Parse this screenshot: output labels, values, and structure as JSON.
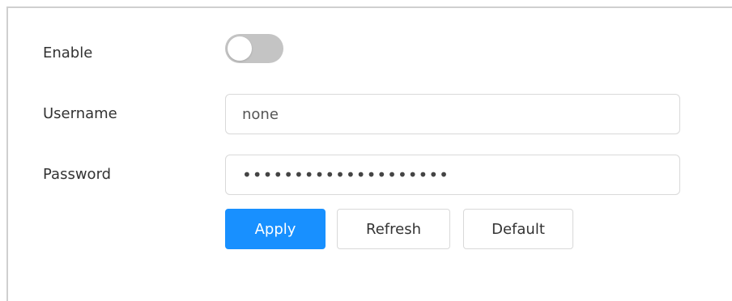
{
  "form": {
    "enable": {
      "label": "Enable",
      "enabled": false
    },
    "username": {
      "label": "Username",
      "value": "none"
    },
    "password": {
      "label": "Password",
      "value": "••••••••••••••••••••"
    }
  },
  "buttons": {
    "apply": "Apply",
    "refresh": "Refresh",
    "default": "Default"
  },
  "colors": {
    "primary": "#1890ff",
    "toggle_off": "#c4c4c4"
  }
}
